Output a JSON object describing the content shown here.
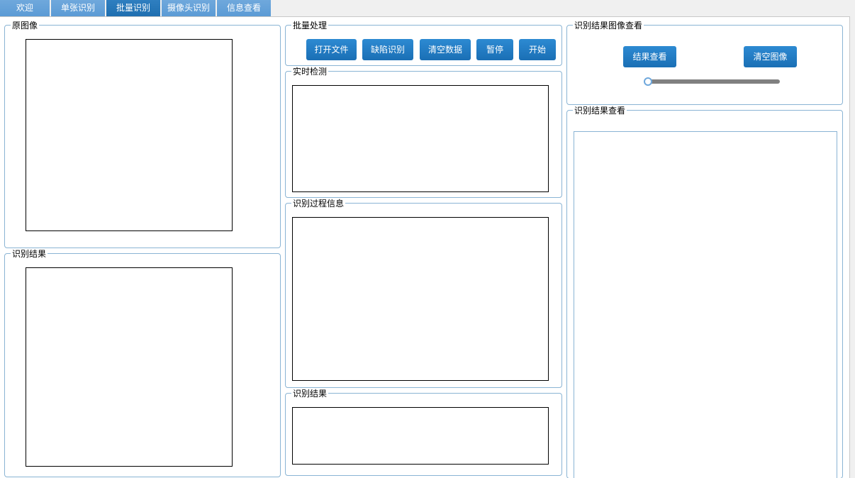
{
  "tabs": [
    {
      "label": "欢迎"
    },
    {
      "label": "单张识别"
    },
    {
      "label": "批量识别"
    },
    {
      "label": "摄像头识别"
    },
    {
      "label": "信息查看"
    }
  ],
  "active_tab": "批量识别",
  "left": {
    "original_title": "原图像",
    "result_title": "识别结果"
  },
  "batch": {
    "title": "批量处理",
    "open_file": "打开文件",
    "defect_detect": "缺陷识别",
    "clear_data": "清空数据",
    "pause": "暂停",
    "start": "开始"
  },
  "realtime": {
    "title": "实时检测"
  },
  "process_info": {
    "title": "识别过程信息"
  },
  "mid_result": {
    "title": "识别结果"
  },
  "image_view": {
    "title": "识别结果图像查看",
    "view_result": "结果查看",
    "clear_image": "清空图像",
    "slider_value": 0
  },
  "result_view": {
    "title": "识别结果查看"
  },
  "colors": {
    "accent": "#1f6fb0",
    "tab": "#5b9bd5",
    "group_border": "#8ab4d4",
    "slider_track": "#808080"
  }
}
